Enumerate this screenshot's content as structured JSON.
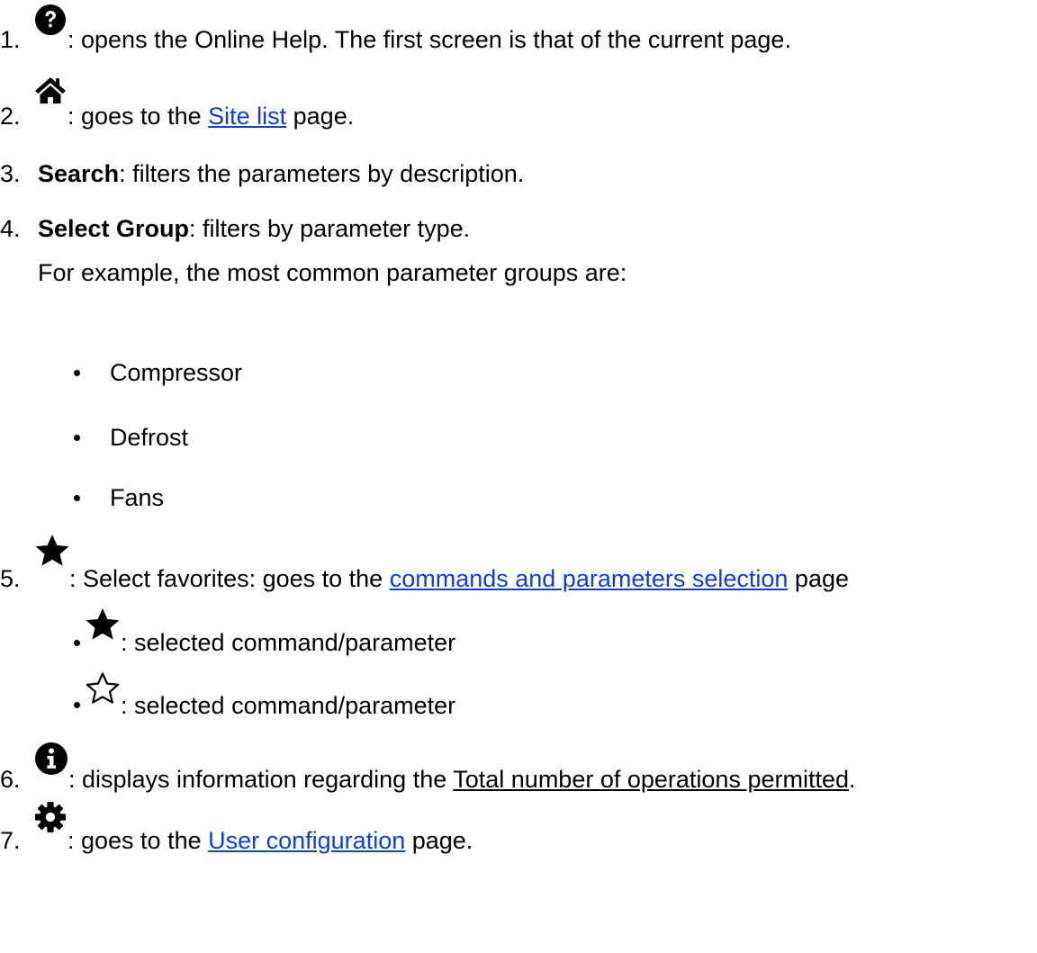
{
  "items": [
    {
      "number": "1.",
      "icon": "question-circle-icon",
      "text": ": opens the Online Help. The first screen is that of the current page."
    },
    {
      "number": "2.",
      "icon": "home-icon",
      "prefix": ": goes to the ",
      "link": "Site list",
      "suffix": " page."
    },
    {
      "number": "3.",
      "bold": "Search",
      "text": ": filters the parameters by description."
    },
    {
      "number": "4.",
      "bold": "Select Group",
      "text": ": filters by parameter type.",
      "note": "For example, the most common parameter groups are:",
      "bullets": [
        "Compressor",
        "Defrost",
        "Fans"
      ]
    },
    {
      "number": "5.",
      "icon": "star-filled-icon",
      "prefix": ": Select favorites: goes to the ",
      "link": "commands and parameters selection",
      "suffix": " page",
      "sub_items": [
        {
          "icon": "star-filled-icon",
          "text": ": selected command/parameter"
        },
        {
          "icon": "star-outline-icon",
          "text": ": selected command/parameter"
        }
      ]
    },
    {
      "number": "6.",
      "icon": "info-circle-icon",
      "prefix": ": displays information regarding the ",
      "underlined": "Total number of operations permitted",
      "suffix": "."
    },
    {
      "number": "7.",
      "icon": "gear-icon",
      "prefix": ": goes to the ",
      "link": "User configuration",
      "suffix": " page."
    }
  ]
}
